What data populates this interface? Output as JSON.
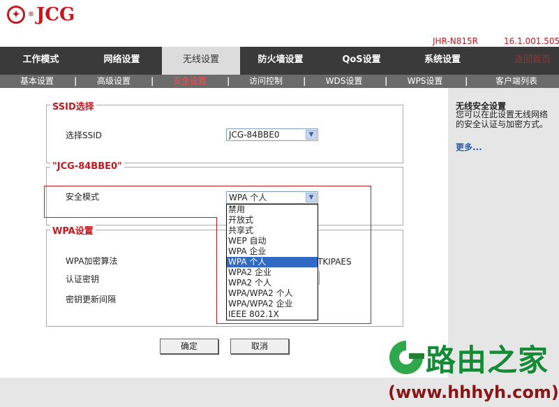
{
  "brand": {
    "name": "JCG",
    "reg": "®",
    "mark": "✦"
  },
  "header": {
    "model": "JHR-N815R",
    "version": "16.1.001.505"
  },
  "main_nav": [
    {
      "label": "工作模式",
      "active": false
    },
    {
      "label": "网络设置",
      "active": false
    },
    {
      "label": "无线设置",
      "active": true
    },
    {
      "label": "防火墙设置",
      "active": false
    },
    {
      "label": "QoS设置",
      "active": false
    },
    {
      "label": "系统设置",
      "active": false
    },
    {
      "label": "返回首页",
      "active": false
    }
  ],
  "sub_nav": {
    "items": [
      {
        "label": "基本设置",
        "active": false
      },
      {
        "label": "高级设置",
        "active": false
      },
      {
        "label": "安全设置",
        "active": true
      },
      {
        "label": "访问控制",
        "active": false
      },
      {
        "label": "WDS设置",
        "active": false
      },
      {
        "label": "WPS设置",
        "active": false
      },
      {
        "label": "客户端列表",
        "active": false
      }
    ],
    "separator": "|"
  },
  "ssid_section": {
    "legend": "SSID选择",
    "label": "选择SSID",
    "value": "JCG-84BBE0"
  },
  "security_section": {
    "legend": "\"JCG-84BBE0\"",
    "label": "安全模式",
    "value": "WPA 个人",
    "options": [
      "禁用",
      "开放式",
      "共享式",
      "WEP 自动",
      "WPA 企业",
      "WPA 个人",
      "WPA2 企业",
      "WPA2 个人",
      "WPA/WPA2 个人",
      "WPA/WPA2 企业",
      "IEEE 802.1X"
    ],
    "selected_index": 5
  },
  "wpa_section": {
    "legend": "WPA设置",
    "cipher_label": "WPA加密算法",
    "cipher_value_partial": "TKIPAES",
    "key_label": "认证密钥",
    "rekey_label": "密钥更新间隔"
  },
  "buttons": {
    "ok": "确定",
    "cancel": "取消"
  },
  "sidebar": {
    "title": "无线安全设置",
    "text": "您可以在此设置无线网络的安全认证与加密方式。",
    "more": "更多..."
  },
  "watermark": {
    "text": "路由之家",
    "url": "(www.hhhyh.com)"
  },
  "colors": {
    "accent": "#c8161e",
    "nav_bg": "#3a3a3a",
    "subnav_bg": "#6b6b6b",
    "selection": "#316ac5",
    "watermark_green": "#138a34"
  }
}
